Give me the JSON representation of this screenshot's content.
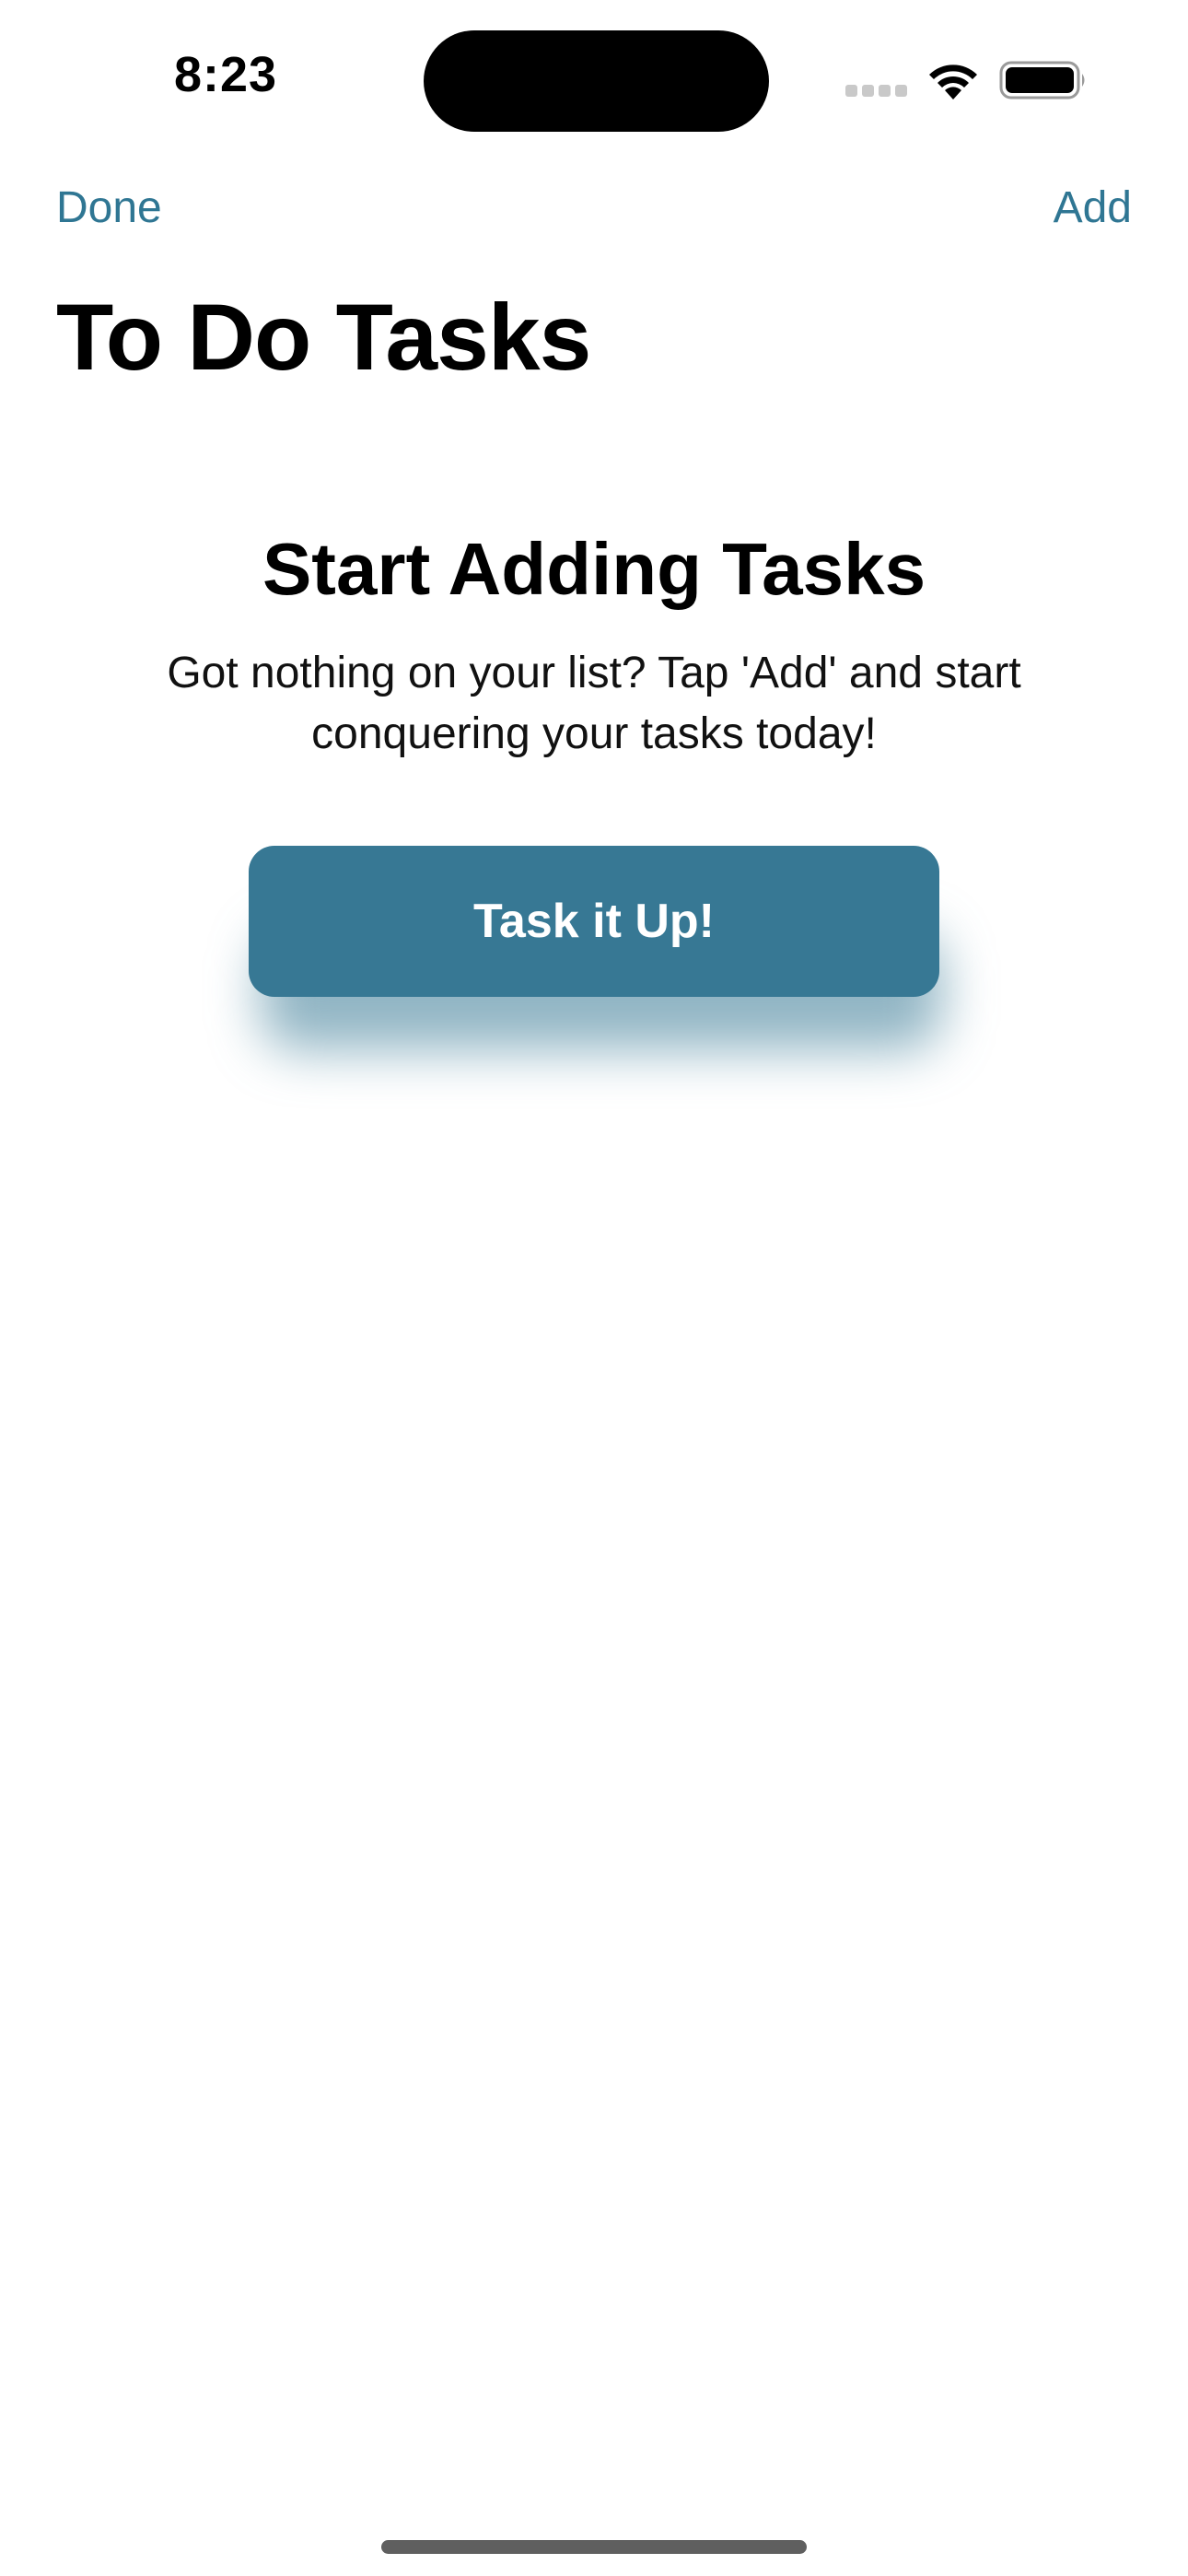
{
  "status_bar": {
    "time": "8:23",
    "icons": [
      "cellular-signal-icon",
      "wifi-icon",
      "battery-icon"
    ]
  },
  "nav": {
    "left_button": "Done",
    "right_button": "Add"
  },
  "page": {
    "title": "To Do Tasks"
  },
  "empty_state": {
    "title": "Start Adding Tasks",
    "message": "Got nothing on your list? Tap 'Add' and start conquering your tasks today!",
    "cta_label": "Task it Up!"
  },
  "colors": {
    "accent": "#2f7693",
    "button_background": "#377894",
    "button_text": "#ffffff",
    "background": "#ffffff"
  }
}
